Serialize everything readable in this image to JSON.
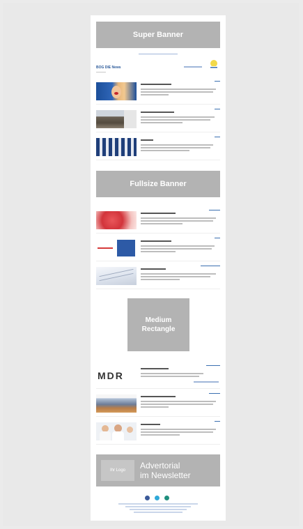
{
  "colors": {
    "banner": "#b3b3b3",
    "accent": "#3a6fb0",
    "background": "#e9e9e9",
    "sheet": "#ffffff"
  },
  "banners": {
    "super": "Super Banner",
    "fullsize": "Fullsize Banner",
    "medium_line1": "Medium",
    "medium_line2": "Rectangle",
    "advertorial_logo": "Ihr Logo",
    "advertorial_line1": "Advertorial",
    "advertorial_line2": "im Newsletter"
  },
  "header": {
    "title": "BOG DIE News"
  },
  "social_icons": [
    "facebook-icon",
    "twitter-icon",
    "xing-icon"
  ]
}
